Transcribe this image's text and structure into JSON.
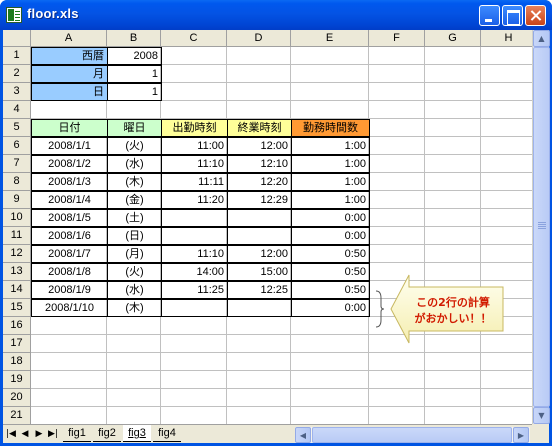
{
  "window": {
    "title": "floor.xls"
  },
  "columns": [
    "A",
    "B",
    "C",
    "D",
    "E",
    "F",
    "G",
    "H"
  ],
  "rows": [
    "1",
    "2",
    "3",
    "4",
    "5",
    "6",
    "7",
    "8",
    "9",
    "10",
    "11",
    "12",
    "13",
    "14",
    "15",
    "16",
    "17",
    "18",
    "19",
    "20",
    "21"
  ],
  "params": [
    {
      "label": "西暦",
      "value": "2008"
    },
    {
      "label": "月",
      "value": "1"
    },
    {
      "label": "日",
      "value": "1"
    }
  ],
  "table": {
    "headers": [
      "日付",
      "曜日",
      "出勤時刻",
      "終業時刻",
      "勤務時間数"
    ],
    "rows": [
      [
        "2008/1/1",
        "(火)",
        "11:00",
        "12:00",
        "1:00"
      ],
      [
        "2008/1/2",
        "(水)",
        "11:10",
        "12:10",
        "1:00"
      ],
      [
        "2008/1/3",
        "(木)",
        "11:11",
        "12:20",
        "1:00"
      ],
      [
        "2008/1/4",
        "(金)",
        "11:20",
        "12:29",
        "1:00"
      ],
      [
        "2008/1/5",
        "(土)",
        "",
        "",
        "0:00"
      ],
      [
        "2008/1/6",
        "(日)",
        "",
        "",
        "0:00"
      ],
      [
        "2008/1/7",
        "(月)",
        "11:10",
        "12:00",
        "0:50"
      ],
      [
        "2008/1/8",
        "(火)",
        "14:00",
        "15:00",
        "0:50"
      ],
      [
        "2008/1/9",
        "(水)",
        "11:25",
        "12:25",
        "0:50"
      ],
      [
        "2008/1/10",
        "(木)",
        "",
        "",
        "0:00"
      ]
    ]
  },
  "callout": {
    "line1": "この2行の計算",
    "line2": "がおかしい！！"
  },
  "sheet_tabs": [
    "fig1",
    "fig2",
    "fig3",
    "fig4"
  ],
  "active_tab": "fig3",
  "colors": {
    "param_label_bg": "#99ccff",
    "hdr_date": "#ccffcc",
    "hdr_day": "#ccffcc",
    "hdr_in": "#ffff99",
    "hdr_out": "#ffff99",
    "hdr_hours": "#ff9933",
    "callout_fill": "#ffffcc",
    "callout_text": "#d11a00"
  }
}
